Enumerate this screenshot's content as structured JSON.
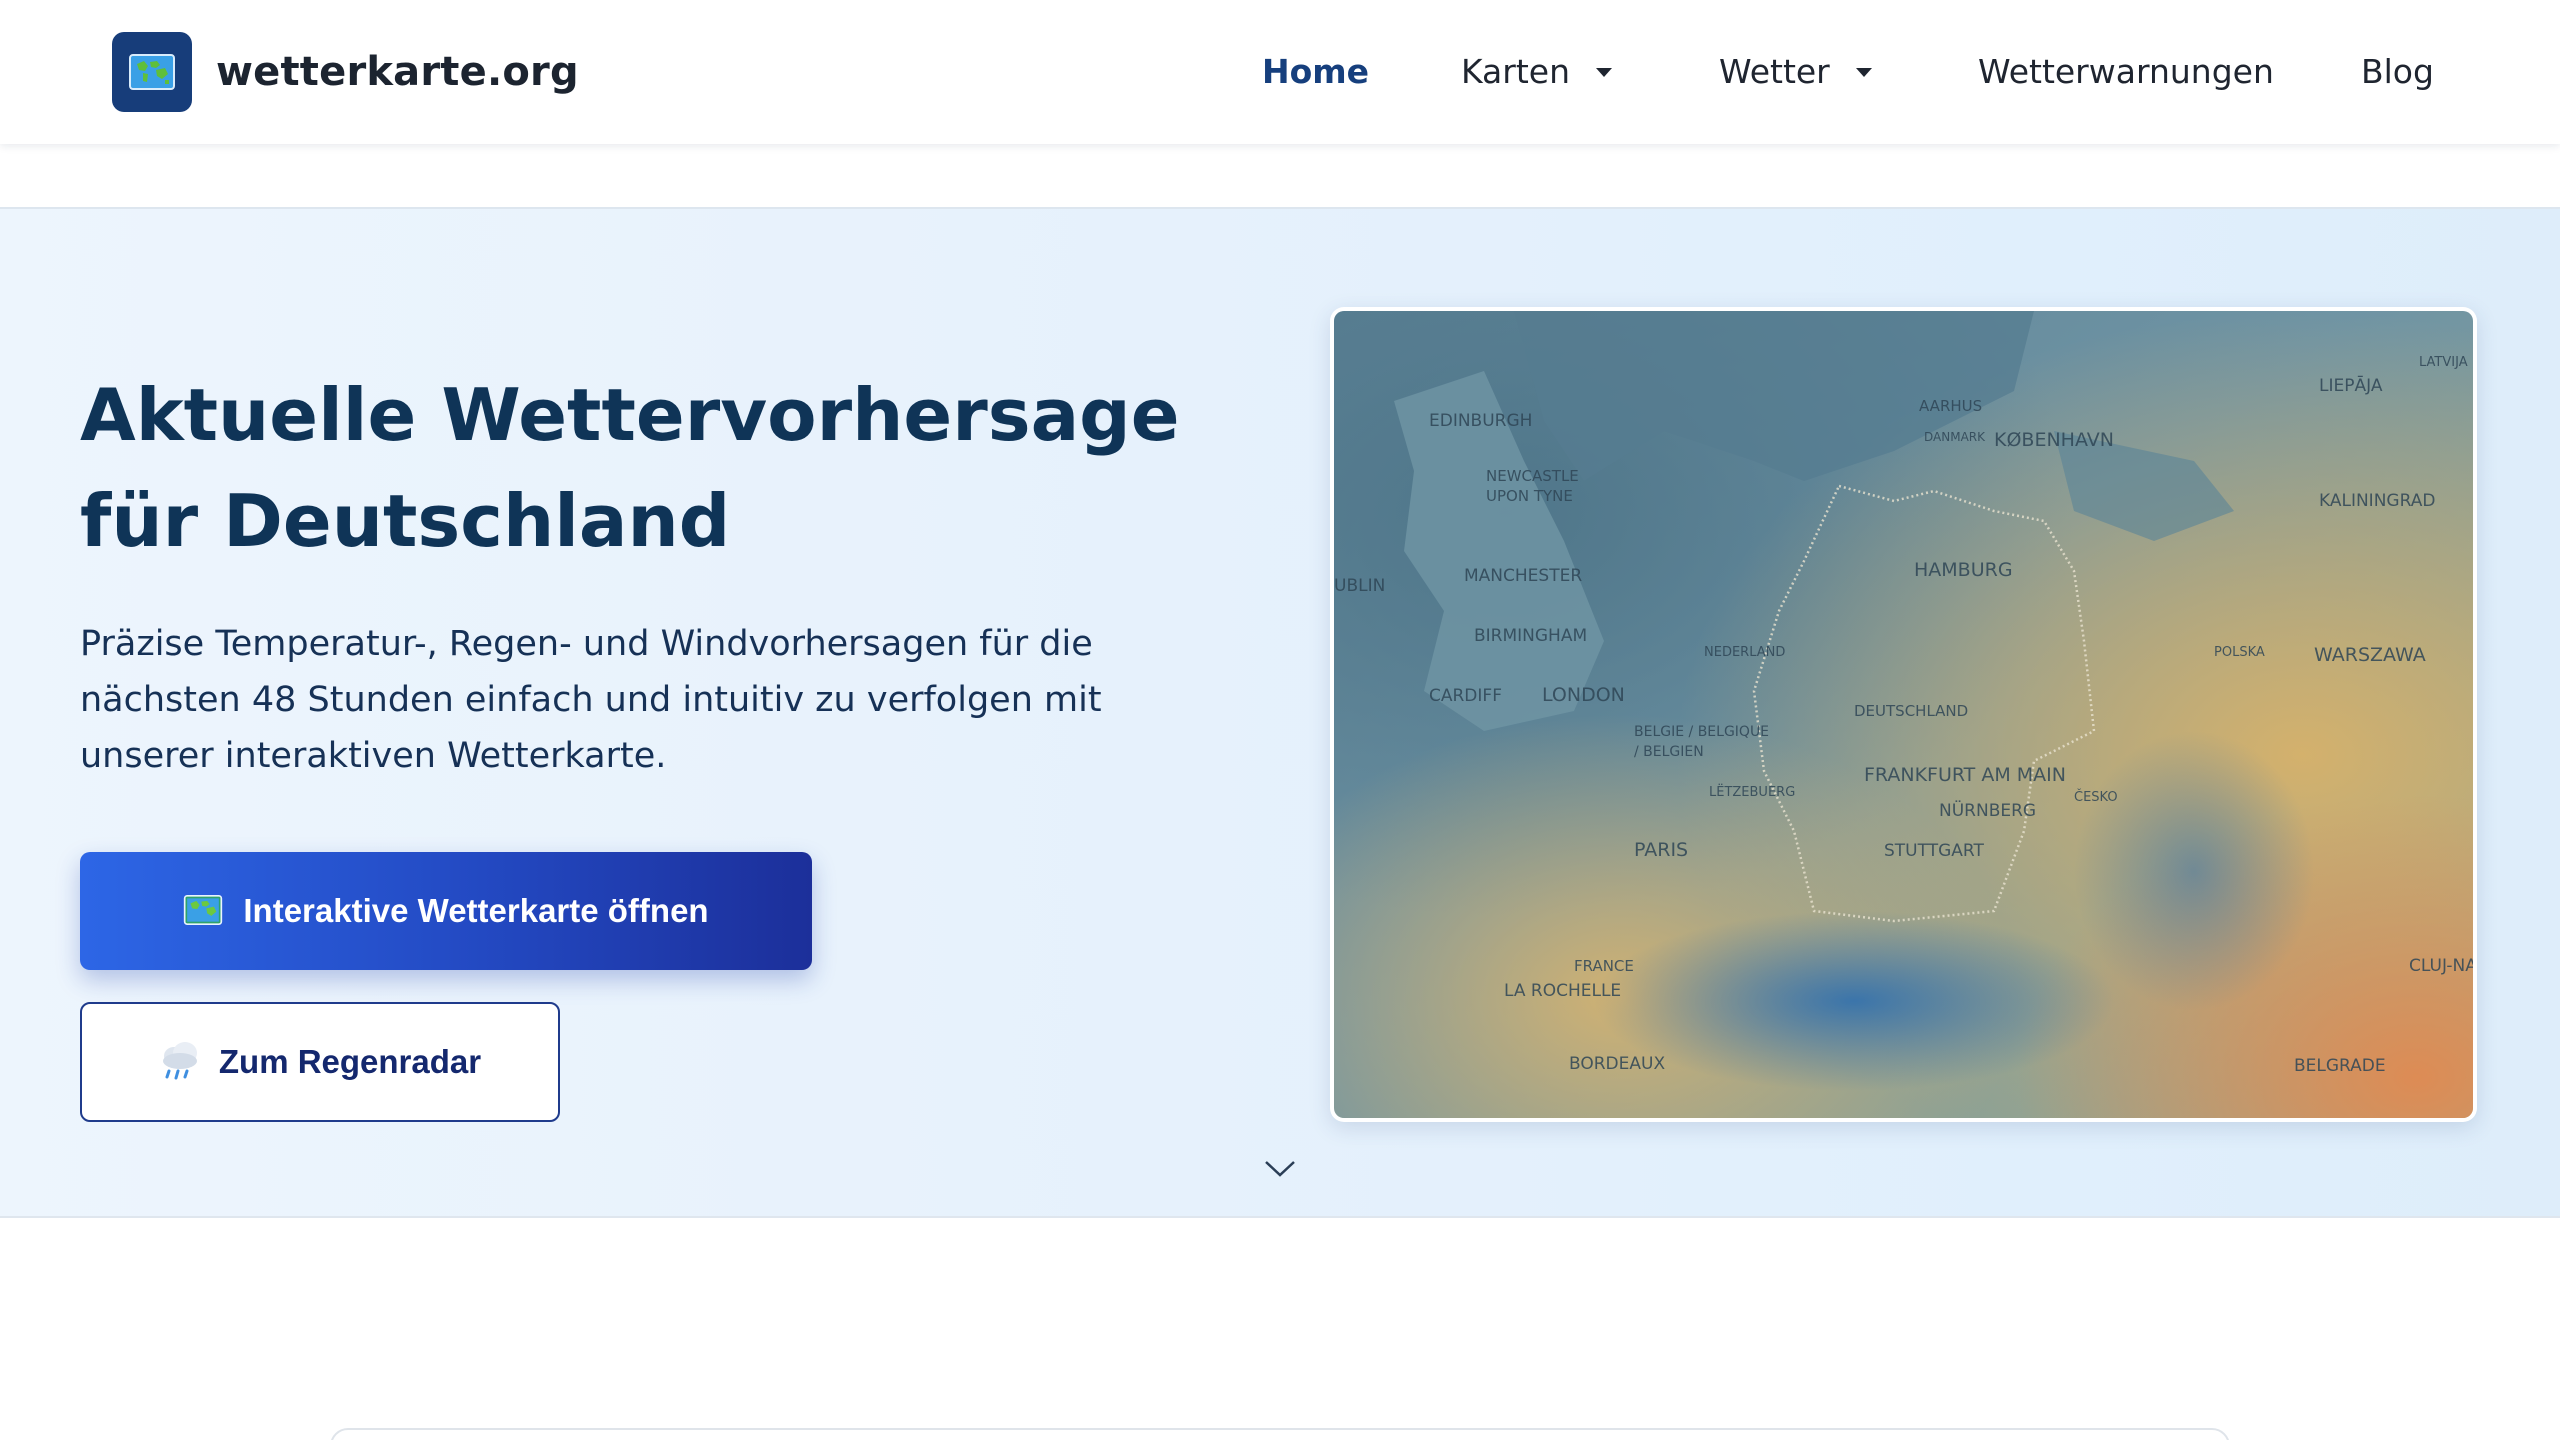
{
  "header": {
    "brand": {
      "name": "wetterkarte.org",
      "logo_icon": "world-map-icon"
    },
    "nav": [
      {
        "label": "Home",
        "active": true,
        "dropdown": false
      },
      {
        "label": "Karten",
        "active": false,
        "dropdown": true
      },
      {
        "label": "Wetter",
        "active": false,
        "dropdown": true
      },
      {
        "label": "Wetterwarnungen",
        "active": false,
        "dropdown": false
      },
      {
        "label": "Blog",
        "active": false,
        "dropdown": false
      }
    ]
  },
  "hero": {
    "title_line1": "Aktuelle Wettervorhersage",
    "title_line2": "für Deutschland",
    "subtitle_line1": "Präzise Temperatur-, Regen- und Windvorhersagen für die",
    "subtitle_line2": "nächsten 48 Stunden einfach und intuitiv zu verfolgen mit",
    "subtitle_line3": "unserer interaktiven Wetterkarte.",
    "primary_button": {
      "label": "Interaktive Wetterkarte öffnen",
      "icon": "world-map-icon"
    },
    "secondary_button": {
      "label": "Zum Regenradar",
      "icon": "rain-cloud-icon"
    },
    "map": {
      "cities": [
        "EDINBURGH",
        "NEWCASTLE",
        "UPON TYNE",
        "MANCHESTER",
        "BIRMINGHAM",
        "CARDIFF",
        "LONDON",
        "AARHUS",
        "KØBENHAVN",
        "LIEPĀJA",
        "KALININGRAD",
        "HAMBURG",
        "DEUTSCHLAND",
        "WARSZAWA",
        "BELGIE / BELGIQUE",
        "/ BELGIEN",
        "FRANKFURT AM MAIN",
        "NÜRNBERG",
        "STUTTGART",
        "PARIS",
        "FRANCE",
        "LA ROCHELLE",
        "BORDEAUX",
        "BELGRADE",
        "CLUJ-NA",
        "LATVIJA",
        "DANMARK",
        "NEDERLAND",
        "POLSKA",
        "ČESKO",
        "LËTZEBUERG",
        "UBLIN"
      ]
    },
    "scroll_icon": "chevron-down-icon"
  },
  "colors": {
    "brand_dark": "#0f3457",
    "active_nav": "#163f7d",
    "primary_button_start": "#2d66e6",
    "primary_button_end": "#1c2f9a",
    "hero_background": "#e6f1fc"
  }
}
